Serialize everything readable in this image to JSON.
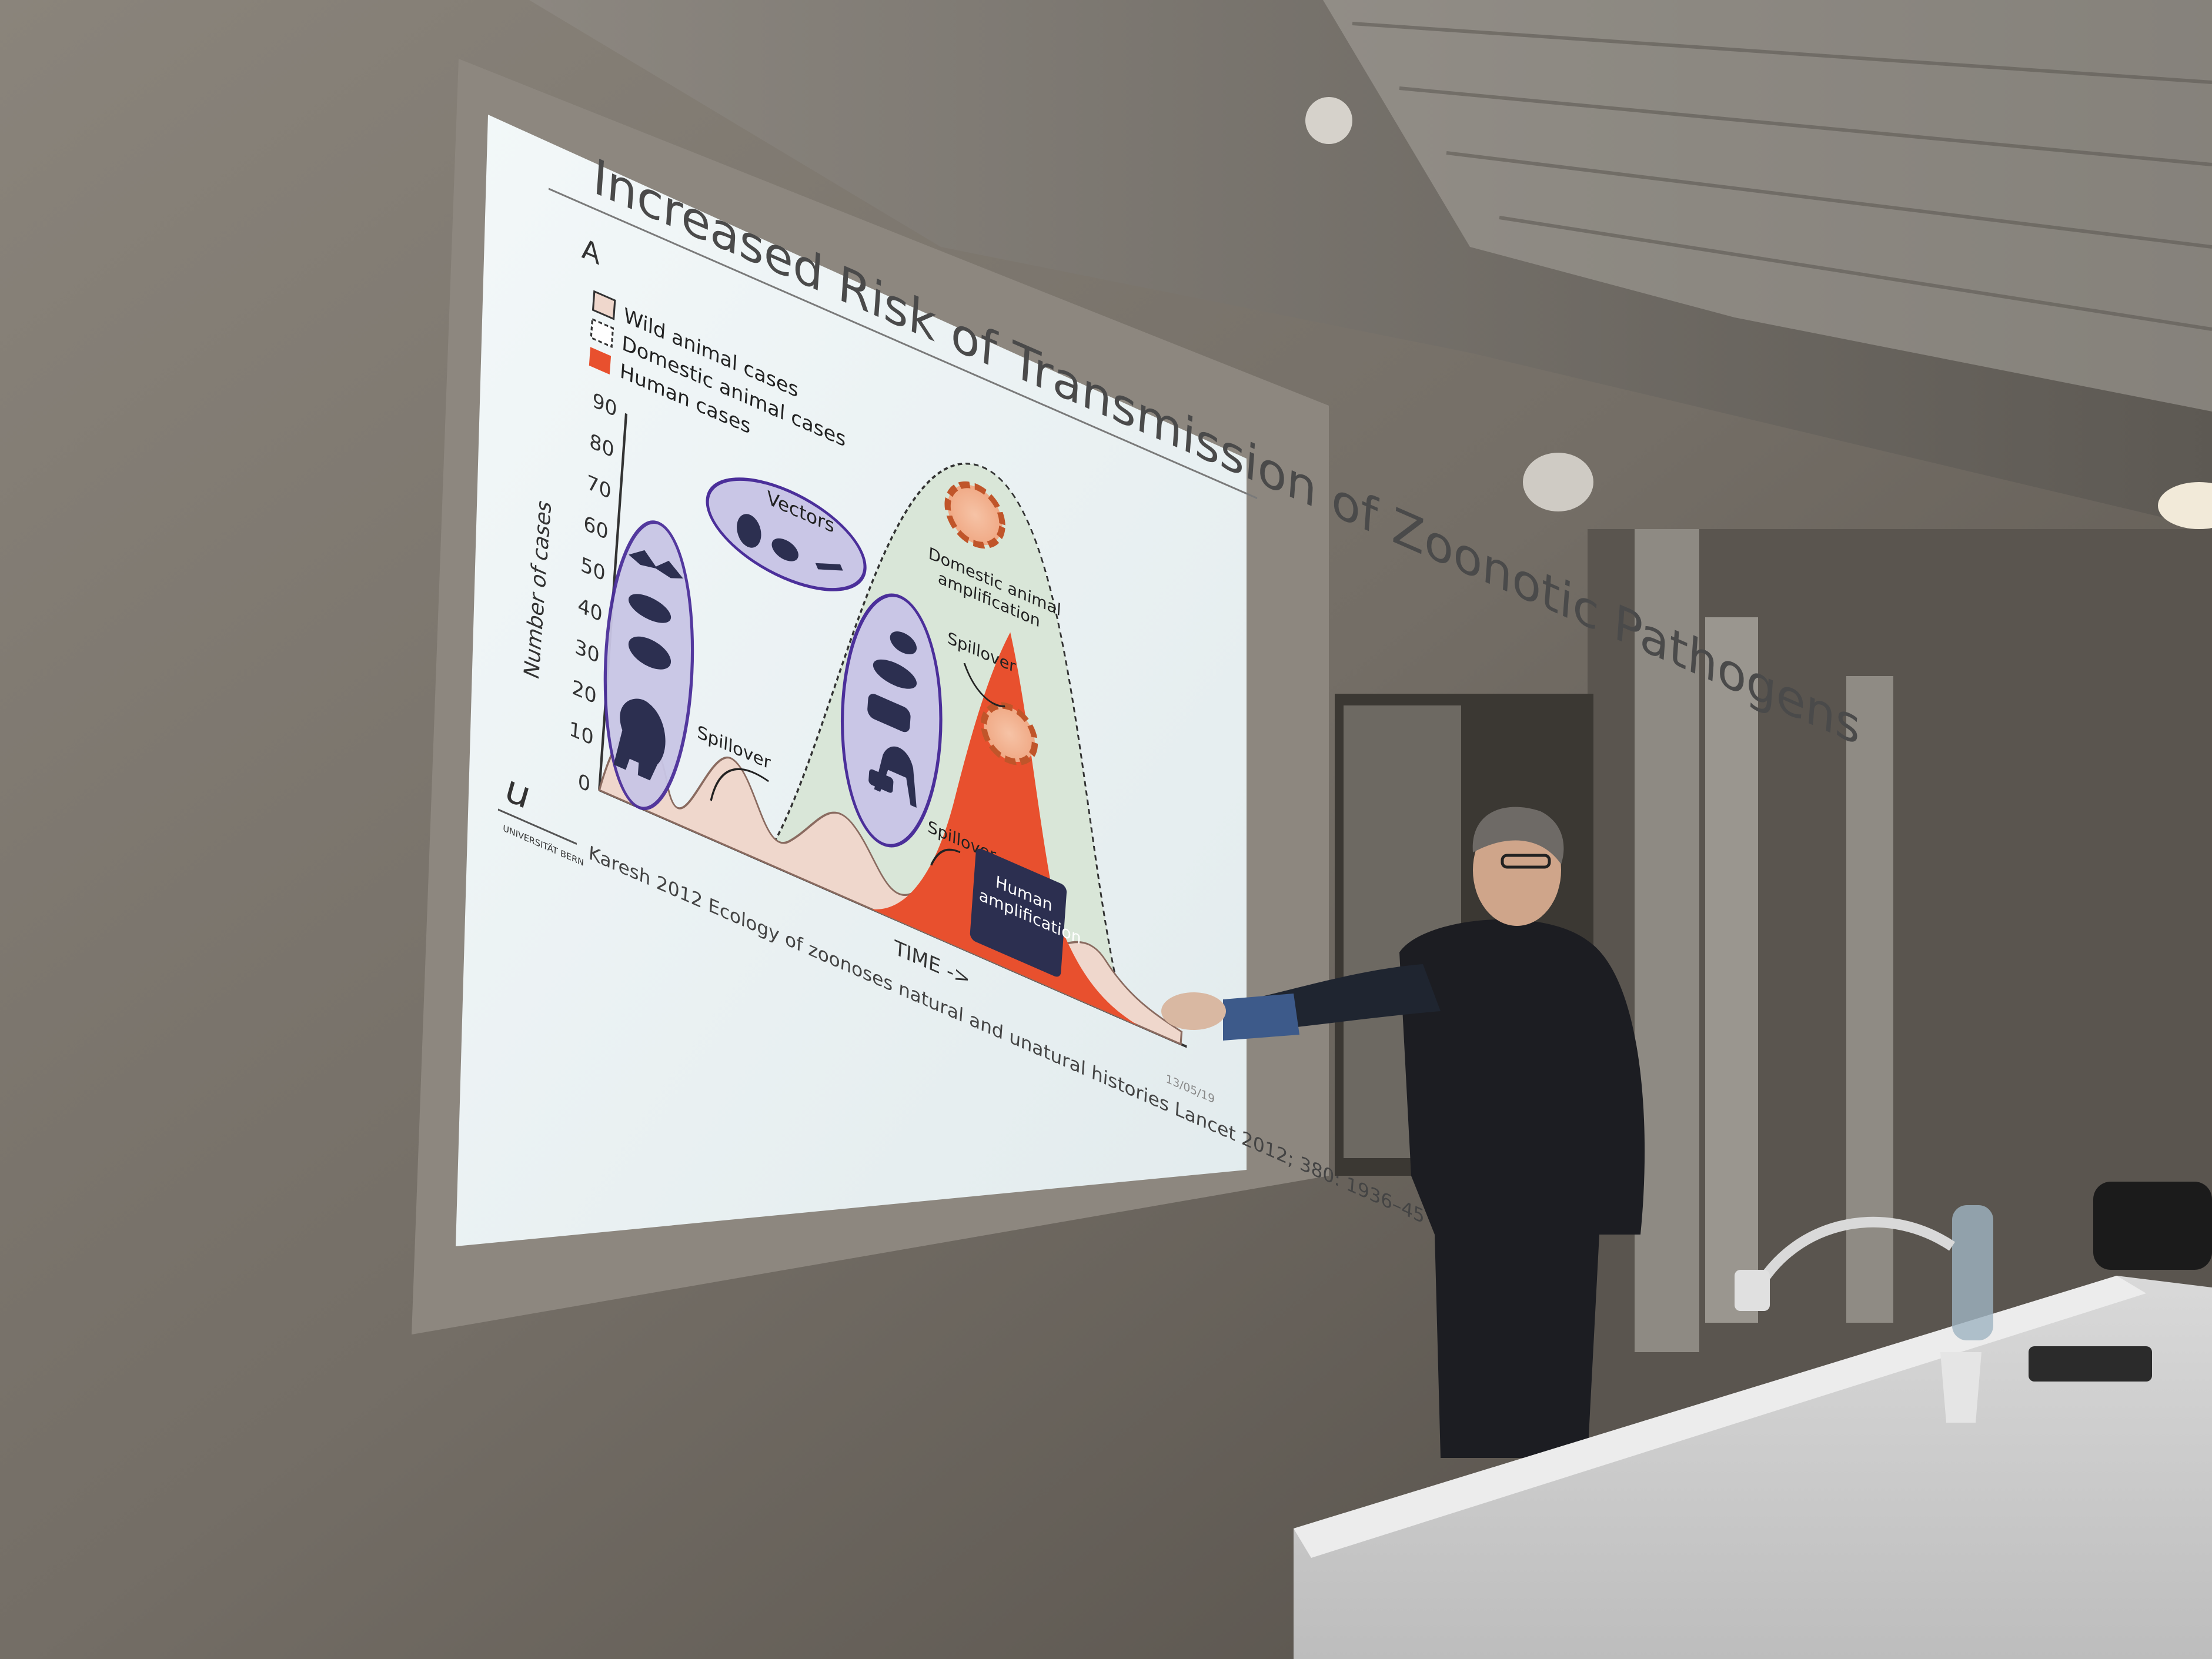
{
  "slide": {
    "title": "Increased Risk of Transmission of Zoonotic Pathogens",
    "panel_letter": "A",
    "legend": [
      {
        "label": "Wild animal cases",
        "swatch": "#efd7cc",
        "style": "solid"
      },
      {
        "label": "Domestic animal cases",
        "swatch": "#ffffff",
        "style": "dashed"
      },
      {
        "label": "Human cases",
        "swatch": "#e8502e",
        "style": "solid"
      }
    ],
    "y_axis_label": "Number of cases",
    "y_ticks": [
      "90",
      "80",
      "70",
      "60",
      "50",
      "40",
      "30",
      "20",
      "10",
      "0"
    ],
    "x_axis_label": "TIME ->",
    "annotations": {
      "vectors": "Vectors",
      "spillover_1": "Spillover",
      "spillover_2": "Spillover",
      "spillover_3": "Spillover",
      "domestic_line1": "Domestic animal",
      "domestic_line2": "amplification",
      "human_line1": "Human",
      "human_line2": "amplification"
    },
    "citation": "Karesh 2012 Ecology of zoonoses natural and unatural histories Lancet 2012; 380: 1936–45",
    "slide_number": "13/05/19",
    "logo_letter": "u",
    "logo_text": "UNIVERSITÄT BERN"
  },
  "colors": {
    "wall": "#7a746c",
    "slide_bg": "#e8eff0",
    "human_cases": "#e8502e",
    "wild_cases": "#efd7cc",
    "domestic_fill": "#d9e6d8",
    "oval_stroke": "#4b2f9a",
    "oval_fill": "#c9c6e6",
    "silhouette": "#2c2f50"
  }
}
